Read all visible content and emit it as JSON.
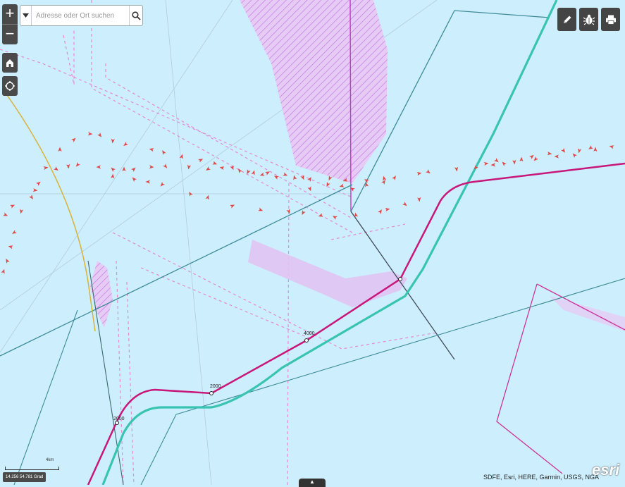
{
  "search": {
    "placeholder": "Adresse oder Ort suchen"
  },
  "zoom": {
    "in_label": "+",
    "out_label": "−"
  },
  "controls": {
    "home_icon": "home-icon",
    "locate_icon": "locate-icon",
    "search_icon": "search-icon",
    "dropdown_icon": "caret-down-icon",
    "draw_icon": "pencil-icon",
    "measure_icon": "bug-icon",
    "print_icon": "printer-icon"
  },
  "route_labels": [
    "2000",
    "2000",
    "4000"
  ],
  "scale": {
    "label": "4km"
  },
  "coordinates": "14.256 54.781 Grad",
  "attribution": "SDFE, Esri, HERE, Garmin, USGS, NGA",
  "logo": "esri",
  "colors": {
    "water": "#cdeefc",
    "route": "#c8177a",
    "route_alt": "#39c4b2",
    "restricted": "#d28be8",
    "vessel": "#e04848"
  }
}
